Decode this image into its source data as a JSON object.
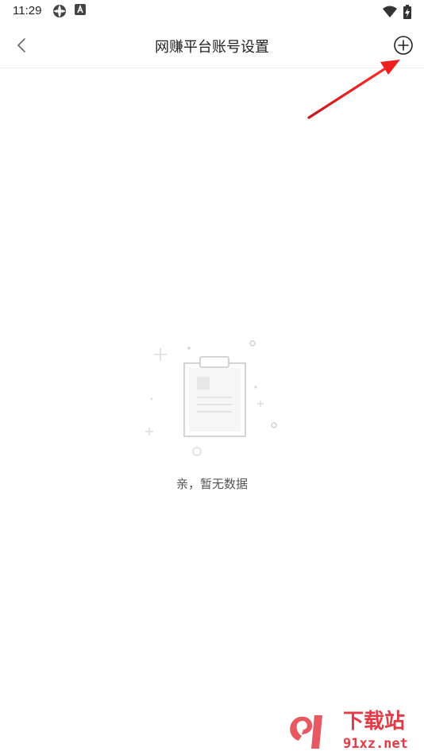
{
  "status_bar": {
    "time": "11:29"
  },
  "header": {
    "title": "网赚平台账号设置"
  },
  "empty_state": {
    "message": "亲，暂无数据"
  },
  "watermark": {
    "brand": "下载站",
    "domain": "91xz.net"
  },
  "colors": {
    "annotation_arrow": "#e02020",
    "watermark": "#e23b47"
  }
}
